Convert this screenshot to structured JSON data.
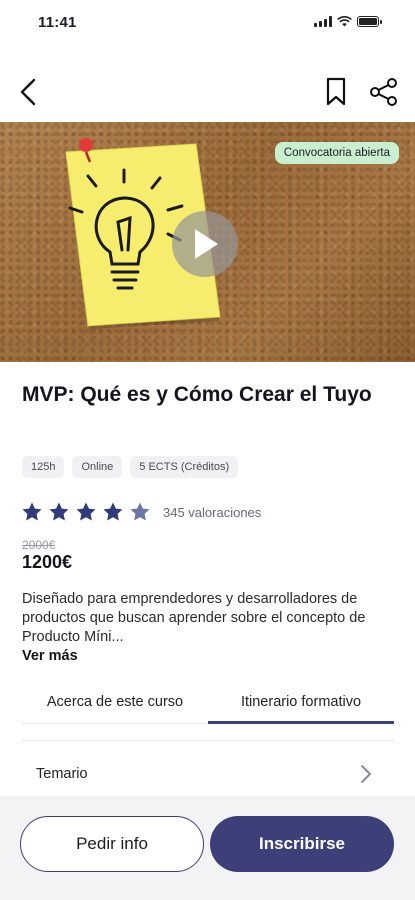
{
  "status_bar": {
    "time": "11:41"
  },
  "nav": {
    "back_icon": "chevron-left-icon",
    "bookmark_icon": "bookmark-icon",
    "share_icon": "share-icon"
  },
  "hero": {
    "status_chip": "Convocatoria abierta",
    "play_icon": "play-icon"
  },
  "course": {
    "title": "MVP: Qué es y Cómo Crear el Tuyo",
    "tags": [
      "125h",
      "Online",
      "5 ECTS (Créditos)"
    ],
    "rating": {
      "stars": 5,
      "ratings_text": "345 valoraciones"
    },
    "old_price": "2000€",
    "price": "1200€",
    "description": "Diseñado para emprendedores y desarrolladores de productos que buscan aprender sobre el concepto de Producto Míni...",
    "read_more": "Ver más"
  },
  "tabs": [
    {
      "label": "Acerca de este curso",
      "active": false
    },
    {
      "label": "Itinerario formativo",
      "active": true
    }
  ],
  "syllabus": {
    "label": "Temario"
  },
  "actions": {
    "info_label": "Pedir info",
    "enroll_label": "Inscribirse"
  },
  "colors": {
    "primary": "#3d3f78",
    "chip_bg": "#c9efcf",
    "star": "#2f3b7a"
  }
}
